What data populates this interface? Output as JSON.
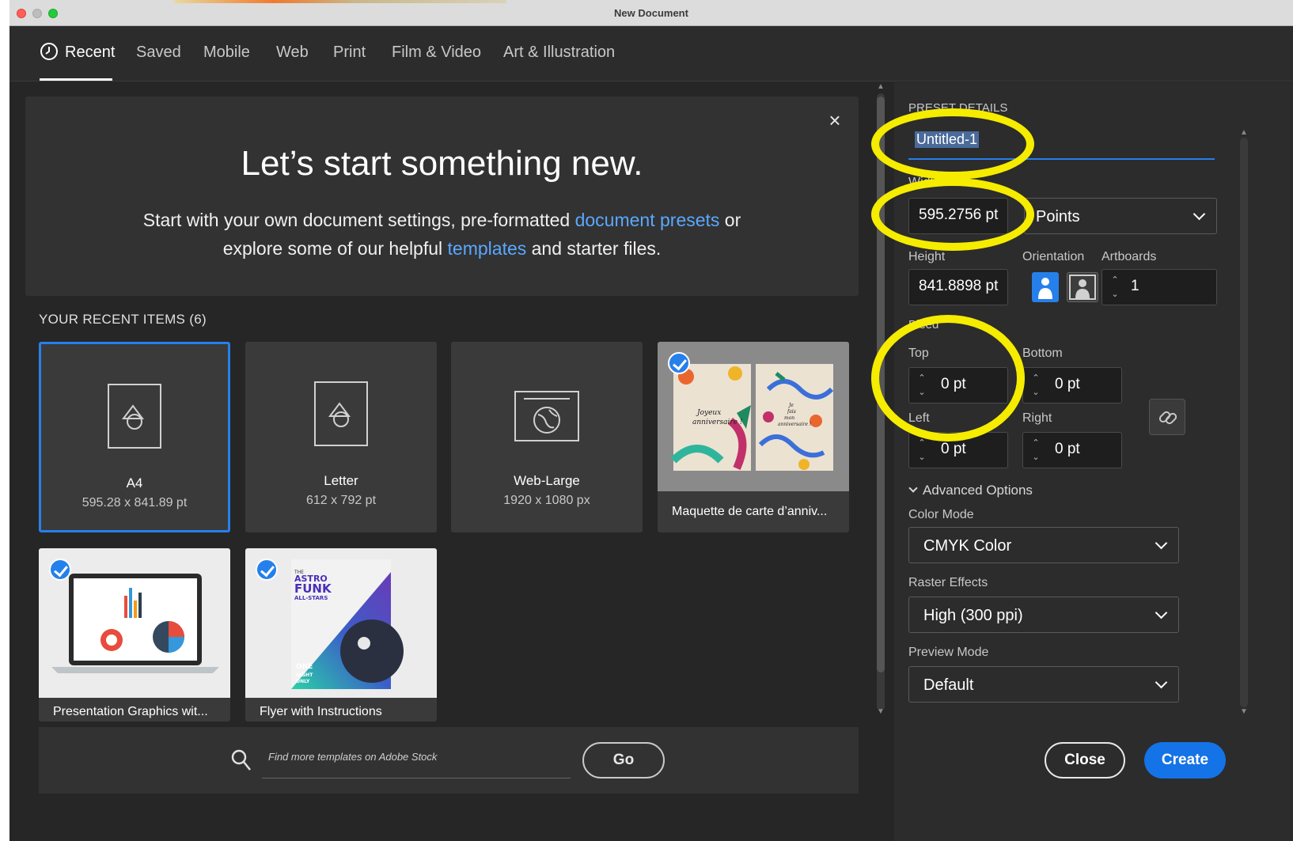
{
  "window": {
    "title": "New Document"
  },
  "tabs": [
    {
      "label": "Recent"
    },
    {
      "label": "Saved"
    },
    {
      "label": "Mobile"
    },
    {
      "label": "Web"
    },
    {
      "label": "Print"
    },
    {
      "label": "Film & Video"
    },
    {
      "label": "Art & Illustration"
    }
  ],
  "banner": {
    "title": "Let’s start something new.",
    "line1_pre": "Start with your own document settings, pre-formatted ",
    "line1_link": "document presets",
    "line1_post": " or",
    "line2_pre": "explore some of our helpful ",
    "line2_link": "templates",
    "line2_post": " and starter files.",
    "close_icon": "×"
  },
  "recent": {
    "heading": "YOUR RECENT ITEMS",
    "count": "(6)",
    "items": [
      {
        "name": "A4",
        "size": "595.28 x 841.89 pt"
      },
      {
        "name": "Letter",
        "size": "612 x 792 pt"
      },
      {
        "name": "Web-Large",
        "size": "1920 x 1080 px"
      },
      {
        "name": "Maquette de carte d’anniv..."
      },
      {
        "name": "Presentation Graphics wit..."
      },
      {
        "name": "Flyer with Instructions"
      }
    ]
  },
  "search": {
    "placeholder": "Find more templates on Adobe Stock",
    "go_label": "Go"
  },
  "preset": {
    "heading": "PRESET DETAILS",
    "name": "Untitled-1",
    "width_label": "Width",
    "width": "595.2756 pt",
    "units": "Points",
    "height_label": "Height",
    "height": "841.8898 pt",
    "orientation_label": "Orientation",
    "artboards_label": "Artboards",
    "artboards": "1",
    "bleed_label": "Bleed",
    "top_label": "Top",
    "top": "0 pt",
    "bottom_label": "Bottom",
    "bottom": "0 pt",
    "left_label": "Left",
    "left": "0 pt",
    "right_label": "Right",
    "right": "0 pt",
    "advanced_label": "Advanced Options",
    "color_mode_label": "Color Mode",
    "color_mode": "CMYK Color",
    "raster_label": "Raster Effects",
    "raster": "High (300 ppi)",
    "preview_label": "Preview Mode",
    "preview": "Default"
  },
  "actions": {
    "close_label": "Close",
    "create_label": "Create"
  },
  "thumbs": {
    "birthday_left": "Joyeux anniversaire !",
    "birthday_right": "Je fais mon anniversaire !",
    "flyer_top": "THE",
    "flyer_title": "ASTRO FUNK ALL-STARS",
    "flyer_bottom": "ONE NIGHT ONLY"
  },
  "colors": {
    "accent": "#2680eb",
    "highlight": "#f5ec00",
    "background": "#262626"
  }
}
